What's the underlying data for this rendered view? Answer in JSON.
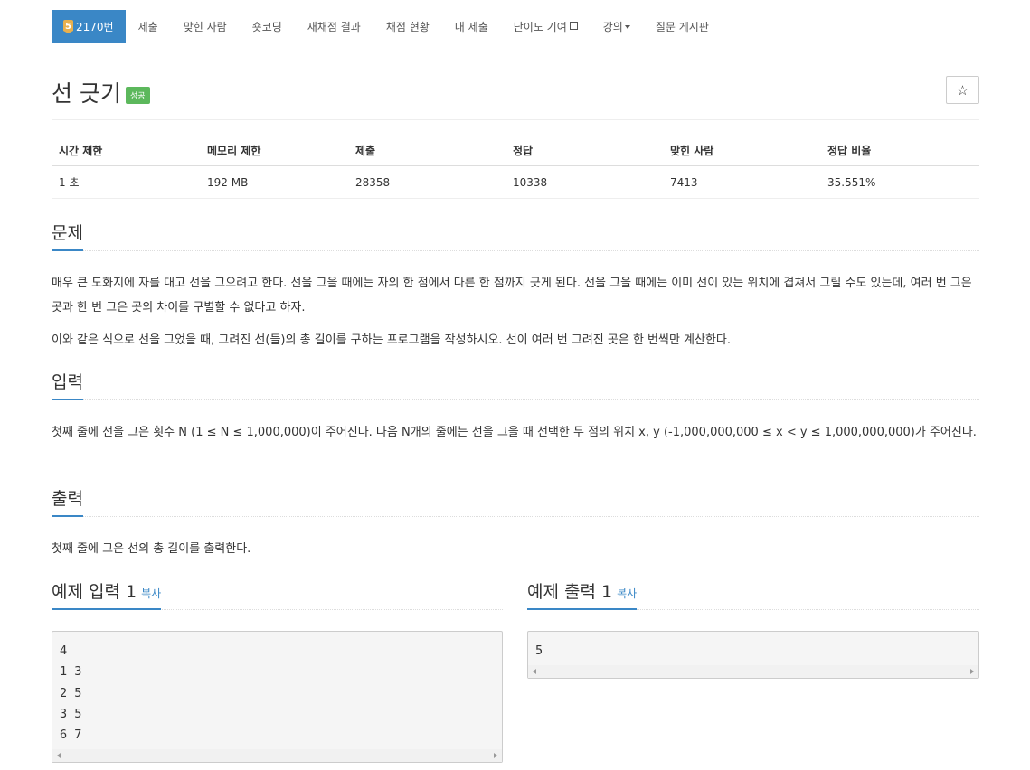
{
  "nav": {
    "problem_tier": "5",
    "problem_number": "2170번",
    "items": [
      "제출",
      "맞힌 사람",
      "숏코딩",
      "재채점 결과",
      "채점 현황",
      "내 제출",
      "난이도 기여",
      "강의",
      "질문 게시판"
    ]
  },
  "problem": {
    "title": "선 긋기",
    "badge": "성공",
    "star_icon": "☆"
  },
  "info": {
    "headers": [
      "시간 제한",
      "메모리 제한",
      "제출",
      "정답",
      "맞힌 사람",
      "정답 비율"
    ],
    "values": [
      "1 초",
      "192 MB",
      "28358",
      "10338",
      "7413",
      "35.551%"
    ]
  },
  "sections": {
    "description": {
      "heading": "문제",
      "p1": "매우 큰 도화지에 자를 대고 선을 그으려고 한다. 선을 그을 때에는 자의 한 점에서 다른 한 점까지 긋게 된다. 선을 그을 때에는 이미 선이 있는 위치에 겹쳐서 그릴 수도 있는데, 여러 번 그은 곳과 한 번 그은 곳의 차이를 구별할 수 없다고 하자.",
      "p2": "이와 같은 식으로 선을 그었을 때, 그려진 선(들)의 총 길이를 구하는 프로그램을 작성하시오. 선이 여러 번 그려진 곳은 한 번씩만 계산한다."
    },
    "input": {
      "heading": "입력",
      "p1": "첫째 줄에 선을 그은 횟수 N (1 ≤ N ≤ 1,000,000)이 주어진다. 다음 N개의 줄에는 선을 그을 때 선택한 두 점의 위치 x, y (-1,000,000,000 ≤ x < y ≤ 1,000,000,000)가 주어진다."
    },
    "output": {
      "heading": "출력",
      "p1": "첫째 줄에 그은 선의 총 길이를 출력한다."
    }
  },
  "samples": {
    "input": {
      "heading": "예제 입력 1",
      "copy_label": "복사",
      "lines": [
        "4",
        "1 3",
        "2 5",
        "3 5",
        "6 7"
      ]
    },
    "output": {
      "heading": "예제 출력 1",
      "copy_label": "복사",
      "lines": [
        "5"
      ]
    }
  }
}
